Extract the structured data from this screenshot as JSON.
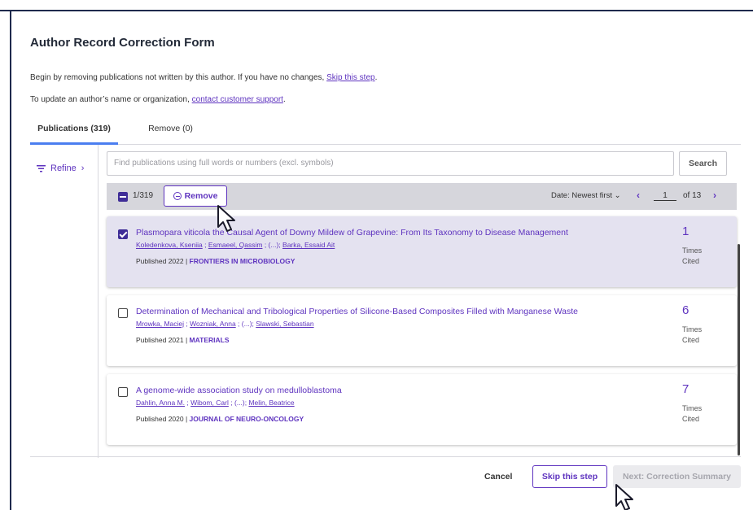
{
  "form": {
    "title": "Author Record Correction Form",
    "intro_text": "Begin by removing publications not written by this author. If you have no changes, ",
    "intro_link": "Skip this step",
    "intro_end": ".",
    "update_text": "To update an author’s name or organization, ",
    "update_link": "contact customer support",
    "update_end": "."
  },
  "tabs": [
    {
      "label": "Publications (319)",
      "active": true
    },
    {
      "label": "Remove (0)",
      "active": false
    }
  ],
  "sidebar": {
    "refine_label": "Refine",
    "filter_icon": "filter-icon",
    "chevron": "›"
  },
  "search": {
    "placeholder": "Find publications using full words or numbers (excl. symbols)",
    "button_label": "Search"
  },
  "toolbar": {
    "selected_count": "1/319",
    "remove_label": "Remove",
    "sort_label": "Date: Newest first ⌄",
    "prev": "‹",
    "page": "1",
    "of_label": "of 13",
    "next": "›"
  },
  "records": [
    {
      "selected": true,
      "title": "Plasmopara viticola the Causal Agent of Downy Mildew of Grapevine: From Its Taxonomy to Disease Management",
      "authors": [
        "Koledenkova, Kseniia",
        "Esmaeel, Qassim",
        "Barka, Essaid Ait"
      ],
      "published": "Published 2022 | ",
      "journal": "FRONTIERS IN MICROBIOLOGY",
      "times_cited": "1",
      "cited_label": "Times Cited"
    },
    {
      "selected": false,
      "title": "Determination of Mechanical and Tribological Properties of Silicone-Based Composites Filled with Manganese Waste",
      "authors": [
        "Mrowka, Maciej",
        "Wozniak, Anna",
        "Slawski, Sebastian"
      ],
      "published": "Published 2021 | ",
      "journal": "MATERIALS",
      "times_cited": "6",
      "cited_label": "Times Cited"
    },
    {
      "selected": false,
      "title": "A genome-wide association study on medulloblastoma",
      "authors": [
        "Dahlin, Anna M.",
        "Wibom, Carl",
        "Melin, Beatrice"
      ],
      "published": "Published 2020 | ",
      "journal": "JOURNAL OF NEURO-ONCOLOGY",
      "times_cited": "7",
      "cited_label": "Times Cited"
    }
  ],
  "footer": {
    "cancel_label": "Cancel",
    "skip_label": "Skip this step",
    "next_label": "Next: Correction Summary"
  },
  "colors": {
    "accent": "#5e33bf",
    "checkbox": "#3f2d97",
    "selected_row": "#e4e2f0",
    "toolbar": "#d6d6dc"
  }
}
